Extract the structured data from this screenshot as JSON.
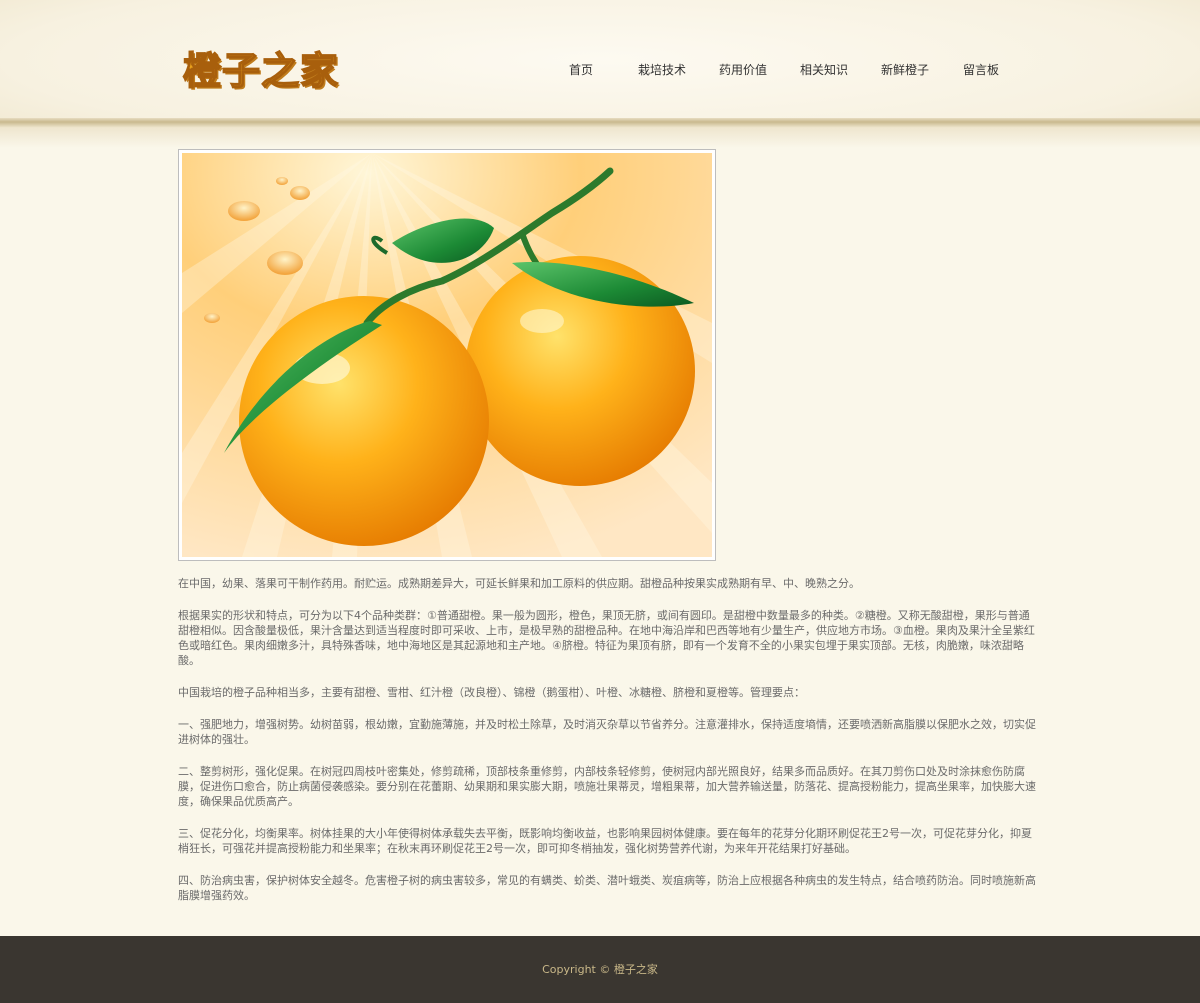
{
  "site": {
    "logo_text": "橙子之家"
  },
  "nav": {
    "items": [
      {
        "label": "首页"
      },
      {
        "label": "栽培技术"
      },
      {
        "label": "药用价值"
      },
      {
        "label": "相关知识"
      },
      {
        "label": "新鲜橙子"
      },
      {
        "label": "留言板"
      }
    ]
  },
  "content": {
    "paragraphs": [
      "在中国，幼果、落果可干制作药用。耐贮运。成熟期差异大，可延长鲜果和加工原料的供应期。甜橙品种按果实成熟期有早、中、晚熟之分。",
      "根据果实的形状和特点，可分为以下4个品种类群：①普通甜橙。果一般为圆形，橙色，果顶无脐，或间有圆印。是甜橙中数量最多的种类。②糖橙。又称无酸甜橙，果形与普通甜橙相似。因含酸量极低，果汁含量达到适当程度时即可采收、上市，是极早熟的甜橙品种。在地中海沿岸和巴西等地有少量生产，供应地方市场。③血橙。果肉及果汁全呈紫红色或暗红色。果肉细嫩多汁，具特殊香味，地中海地区是其起源地和主产地。④脐橙。特征为果顶有脐，即有一个发育不全的小果实包埋于果实顶部。无核，肉脆嫩，味浓甜略酸。",
      "中国栽培的橙子品种相当多，主要有甜橙、雪柑、红汁橙（改良橙）、锦橙（鹅蛋柑）、叶橙、冰糖橙、脐橙和夏橙等。管理要点：",
      "一、强肥地力，增强树势。幼树苗弱，根幼嫩，宜勤施薄施，并及时松土除草，及时消灭杂草以节省养分。注意灌排水，保持适度墒情，还要喷洒新高脂膜以保肥水之效，切实促进树体的强壮。",
      "二、整剪树形，强化促果。在树冠四周枝叶密集处，修剪疏稀，顶部枝条重修剪，内部枝条轻修剪，使树冠内部光照良好，结果多而品质好。在其刀剪伤口处及时涂抹愈伤防腐膜，促进伤口愈合，防止病菌侵袭感染。要分别在花蕾期、幼果期和果实膨大期，喷施壮果蒂灵，增粗果蒂，加大营养输送量，防落花、提高授粉能力，提高坐果率，加快膨大速度，确保果品优质高产。",
      "三、促花分化，均衡果率。树体挂果的大小年使得树体承载失去平衡，既影响均衡收益，也影响果园树体健康。要在每年的花芽分化期环刷促花王2号一次，可促花芽分化，抑夏梢狂长，可强花并提高授粉能力和坐果率；在秋末再环刷促花王2号一次，即可抑冬梢抽发，强化树势营养代谢，为来年开花结果打好基础。",
      "四、防治病虫害，保护树体安全越冬。危害橙子树的病虫害较多，常见的有螨类、蚧类、潜叶蛾类、炭疽病等，防治上应根据各种病虫的发生特点，结合喷药防治。同时喷施新高脂膜增强药效。"
    ]
  },
  "footer": {
    "copyright": "Copyright © 橙子之家"
  },
  "colors": {
    "background": "#faf7ea",
    "footer_bg": "#3a3630",
    "footer_text": "#c9b889",
    "logo_orange": "#e9a01c"
  }
}
